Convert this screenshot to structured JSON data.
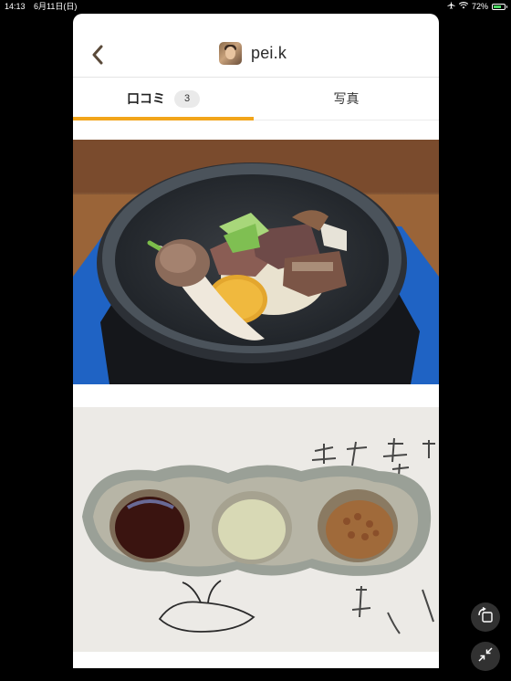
{
  "status_bar": {
    "time": "14:13",
    "date": "6月11日(日)",
    "battery": "72%",
    "battery_fraction": 0.72
  },
  "header": {
    "back_icon": "chevron-left-icon",
    "username": "pei.k"
  },
  "tabs": [
    {
      "label": "口コミ",
      "count": "3",
      "selected": true
    },
    {
      "label": "写真",
      "selected": false
    }
  ],
  "colors": {
    "accent": "#f2a51a",
    "badge_bg": "#eaeaea"
  },
  "photos": [
    {
      "subject": "stone-pot-dish"
    },
    {
      "subject": "sauce-dish"
    }
  ],
  "controls": {
    "rotate_icon": "rotate-screen-icon",
    "shrink_icon": "shrink-arrows-icon"
  }
}
